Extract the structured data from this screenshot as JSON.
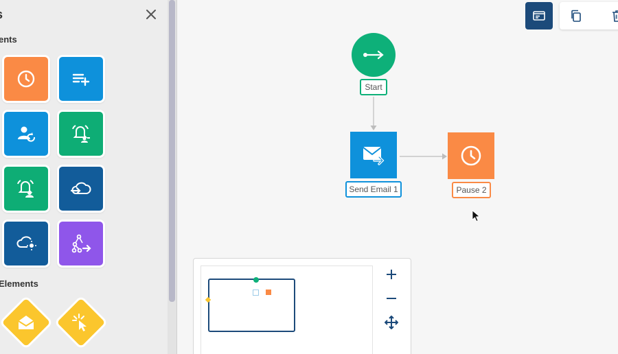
{
  "sidebar": {
    "title": "s",
    "section1_label": "ents",
    "section2_label": "Elements",
    "tiles": [
      {
        "icon": "clock-icon",
        "color": "#fa8a45"
      },
      {
        "icon": "add-list-icon",
        "color": "#0e91db"
      },
      {
        "icon": "user-refresh-icon",
        "color": "#0e91db"
      },
      {
        "icon": "bell-user-icon",
        "color": "#0ead75"
      },
      {
        "icon": "bell-user-icon",
        "color": "#0ead75"
      },
      {
        "icon": "cloud-import-icon",
        "color": "#125c9a"
      },
      {
        "icon": "cloud-idea-icon",
        "color": "#125c9a"
      },
      {
        "icon": "split-path-icon",
        "color": "#8f56ea"
      }
    ],
    "diamonds": [
      {
        "icon": "envelope-open-icon",
        "color": "#fbc62d"
      },
      {
        "icon": "click-cursor-icon",
        "color": "#fbc62d"
      }
    ]
  },
  "toolbar": {
    "primary_icon": "panel-icon",
    "copy_icon": "copy-icon",
    "delete_icon": "trash-icon"
  },
  "flow": {
    "start_label": "Start",
    "email_label": "Send Email 1",
    "pause_label": "Pause 2"
  },
  "colors": {
    "start": "#0eb079",
    "email": "#0e91db",
    "pause": "#fa8a45",
    "navy": "#1c4a7a",
    "connector": "#bdbdbd"
  },
  "minimap": {
    "zoom_in_icon": "plus-icon",
    "zoom_out_icon": "minus-icon",
    "fit_icon": "move-arrows-icon"
  }
}
